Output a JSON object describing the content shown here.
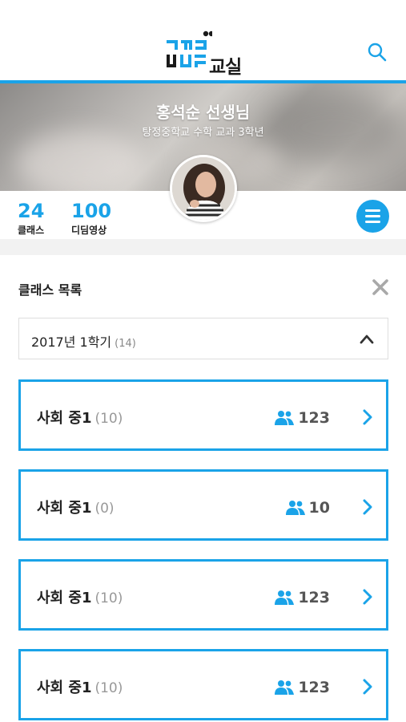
{
  "header": {
    "logo": {
      "text": "교실"
    }
  },
  "profile": {
    "teacher_name": "홍석순 선생님",
    "school_info": "탕정중학교 수학 교과 3학년"
  },
  "stats": [
    {
      "value": "24",
      "label": "클래스"
    },
    {
      "value": "100",
      "label": "디딤영상"
    }
  ],
  "class_section": {
    "title": "클래스 목록",
    "semester": {
      "label": "2017년 1학기",
      "count": "(14)"
    },
    "classes": [
      {
        "name": "사회 중1",
        "count": "(10)",
        "members": "123"
      },
      {
        "name": "사회 중1",
        "count": "(0)",
        "members": "10"
      },
      {
        "name": "사회 중1",
        "count": "(10)",
        "members": "123"
      },
      {
        "name": "사회 중1",
        "count": "(10)",
        "members": "123"
      }
    ]
  },
  "colors": {
    "accent": "#1aa3e8",
    "text": "#222222",
    "muted": "#999999"
  },
  "icons": [
    "logo-mark",
    "search-icon",
    "menu-icon",
    "close-icon",
    "chevron-up-icon",
    "people-icon",
    "chevron-right-icon"
  ]
}
